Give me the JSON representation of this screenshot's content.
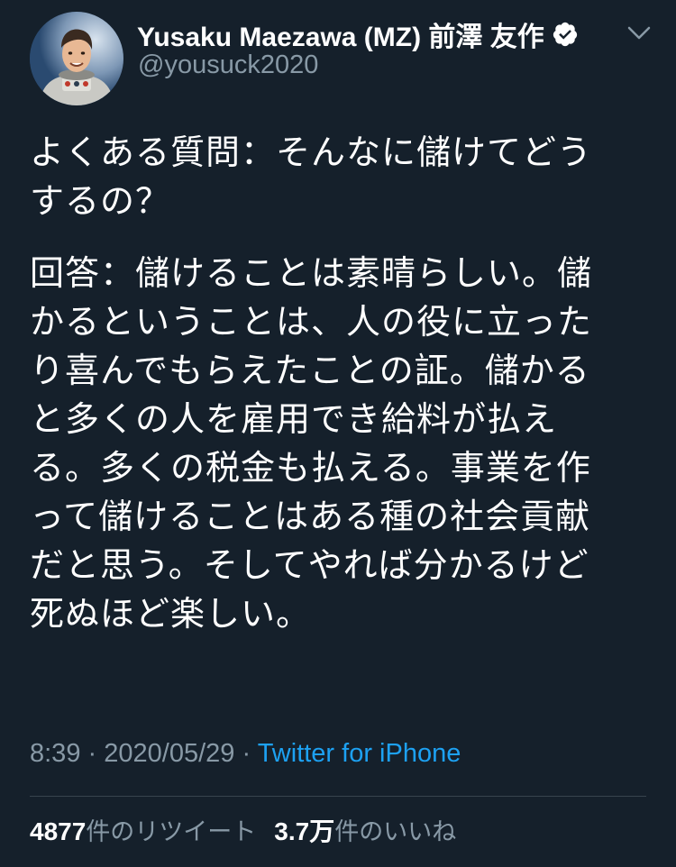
{
  "tweet": {
    "author": {
      "display_name": "Yusaku Maezawa (MZ) 前澤 友作",
      "handle": "@yousuck2020",
      "verified_icon": "verified-badge-icon",
      "avatar_icon": "astronaut-avatar"
    },
    "menu_icon": "chevron-down-icon",
    "text": {
      "question": "よくある質問：そんなに儲けてどう\nするの？",
      "answer": "回答：儲けることは素晴らしい。儲\nかるということは、人の役に立った\nり喜んでもらえたことの証。儲かる\nと多くの人を雇用でき給料が払え\nる。多くの税金も払える。事業を作\nって儲けることはある種の社会貢献\nだと思う。そしてやれば分かるけど\n死ぬほど楽しい。"
    },
    "meta": {
      "time": "8:39",
      "separator": "·",
      "date": "2020/05/29",
      "source": "Twitter for iPhone"
    },
    "stats": {
      "retweet_count": "4877",
      "retweet_label": "件のリツイート",
      "like_count": "3.7万",
      "like_label": "件のいいね"
    }
  },
  "colors": {
    "background": "#15202b",
    "text": "#ffffff",
    "secondary": "#8899a6",
    "link": "#1da1f2",
    "divider": "#38444d"
  }
}
